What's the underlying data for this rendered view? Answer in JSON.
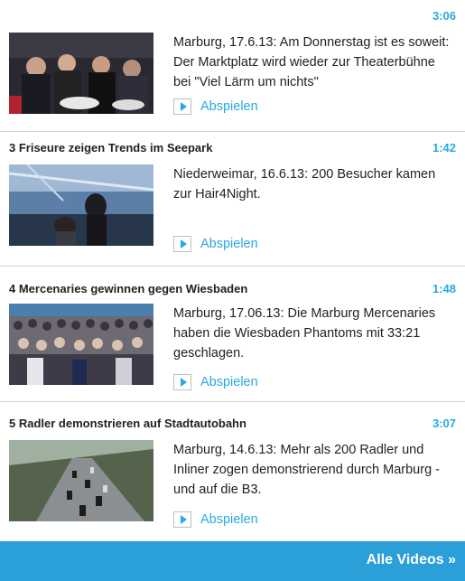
{
  "items": [
    {
      "title": "",
      "duration": "3:06",
      "description": "Marburg, 17.6.13: Am Donnerstag ist es soweit: Der Marktplatz wird wieder zur Theaterbühne bei \"Viel Lärm um nichts\"",
      "play_label": "Abspielen"
    },
    {
      "title": "3 Friseure zeigen Trends im Seepark",
      "duration": "1:42",
      "description": "Niederweimar, 16.6.13: 200 Besucher kamen zur Hair4Night.",
      "play_label": "Abspielen"
    },
    {
      "title": "4 Mercenaries gewinnen gegen Wiesbaden",
      "duration": "1:48",
      "description": "Marburg, 17.06.13: Die Marburg Mercenaries haben die Wiesbaden Phantoms mit 33:21 geschlagen.",
      "play_label": "Abspielen"
    },
    {
      "title": "5 Radler demonstrieren auf Stadtautobahn",
      "duration": "3:07",
      "description": "Marburg, 14.6.13: Mehr als 200 Radler und Inliner zogen demonstrierend durch Marburg -und auf die B3.",
      "play_label": "Abspielen"
    }
  ],
  "footer": {
    "all_videos_label": "Alle Videos »"
  },
  "colors": {
    "accent": "#29a9e0",
    "footer_bg": "#2a9fd8",
    "divider": "#cfcfcf"
  }
}
